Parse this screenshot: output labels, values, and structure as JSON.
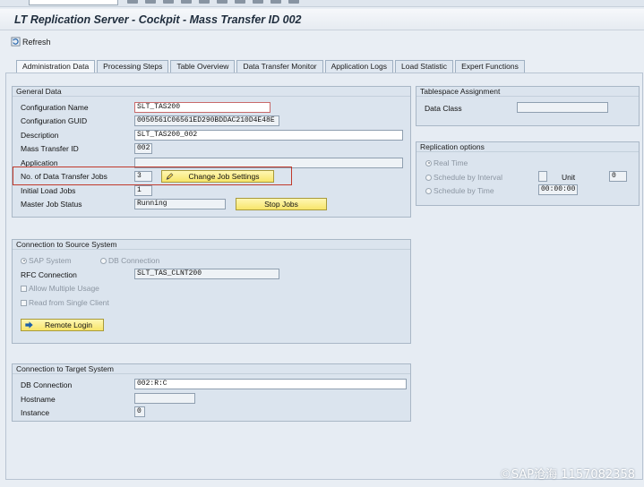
{
  "window": {
    "title": "LT Replication Server - Cockpit - Mass Transfer ID 002"
  },
  "toolbar": {
    "refresh_label": "Refresh"
  },
  "tabs": [
    {
      "label": "Administration Data"
    },
    {
      "label": "Processing Steps"
    },
    {
      "label": "Table Overview"
    },
    {
      "label": "Data Transfer Monitor"
    },
    {
      "label": "Application Logs"
    },
    {
      "label": "Load Statistic"
    },
    {
      "label": "Expert Functions"
    }
  ],
  "general": {
    "title": "General Data",
    "config_name_label": "Configuration Name",
    "config_name_value": "SLT_TAS200",
    "config_guid_label": "Configuration GUID",
    "config_guid_value": "0050561C06561ED290BDDAC210D4E48E",
    "description_label": "Description",
    "description_value": "SLT_TAS200_002",
    "mt_id_label": "Mass Transfer ID",
    "mt_id_value": "002",
    "application_label": "Application",
    "application_value": "",
    "jobs_label": "No. of Data Transfer Jobs",
    "jobs_value": "3",
    "change_jobs_button": "Change Job Settings",
    "initial_jobs_label": "Initial Load Jobs",
    "initial_jobs_value": "1",
    "master_status_label": "Master Job Status",
    "master_status_value": "Running",
    "stop_jobs_button": "Stop Jobs"
  },
  "tablespace": {
    "title": "Tablespace Assignment",
    "data_class_label": "Data Class",
    "data_class_value": ""
  },
  "replication": {
    "title": "Replication options",
    "real_time": "Real Time",
    "schedule_interval": "Schedule by Interval",
    "unit_label": "Unit",
    "unit_value": "0",
    "schedule_time": "Schedule by Time",
    "time_value": "00:00:00"
  },
  "source": {
    "title": "Connection to Source System",
    "sap_system": "SAP System",
    "db_connection": "DB Connection",
    "rfc_label": "RFC Connection",
    "rfc_value": "SLT_TAS_CLNT200",
    "allow_multiple": "Allow Multiple Usage",
    "read_single": "Read from Single Client",
    "remote_login_button": "Remote Login"
  },
  "target": {
    "title": "Connection to Target System",
    "db_conn_label": "DB Connection",
    "db_conn_value": "002:R:C",
    "hostname_label": "Hostname",
    "hostname_value": "",
    "instance_label": "Instance",
    "instance_value": "0"
  },
  "watermark": "©SAP沧海 1157082358",
  "colors": {
    "highlight": "#c0392b",
    "button": "#f7e56a",
    "group_bg": "#dbe4ee"
  }
}
